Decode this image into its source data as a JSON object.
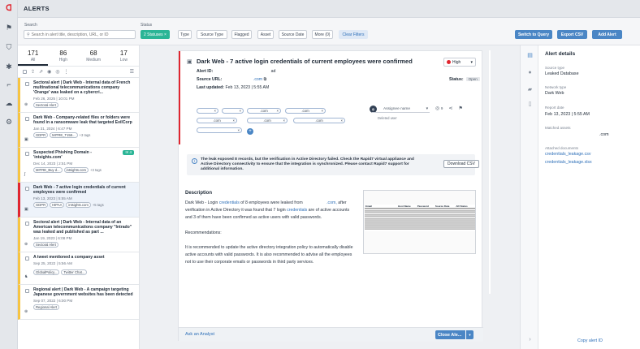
{
  "page_title": "ALERTS",
  "filters": {
    "search_label": "Search",
    "search_placeholder": "Search in alert title, description, URL, or ID",
    "status_label": "Status",
    "status_chip": "2 Statuses",
    "buttons": [
      "Type",
      "Source Type",
      "Flagged",
      "Asset",
      "Source Date",
      "More (0)"
    ],
    "clear": "Clear Filters",
    "switch_query": "Switch to Query",
    "export_csv": "Export CSV",
    "add_alert": "Add Alert"
  },
  "counts": [
    {
      "n": "171",
      "label": "All"
    },
    {
      "n": "86",
      "label": "High"
    },
    {
      "n": "68",
      "label": "Medium"
    },
    {
      "n": "17",
      "label": "Low"
    }
  ],
  "alerts": [
    {
      "title": "Sectoral alert | Dark Web - Internal data of French multinational telecommunications company 'Orange' was leaked on a cybercri...",
      "date": "Feb 26, 2025 | 10:01 PM",
      "tags": [
        "Sectoral Alert"
      ],
      "more": ""
    },
    {
      "title": "Dark Web - Company-related files or folders were found in a ransomware leak that targeted EvilCorp",
      "date": "Jan 31, 2024 | 6:47 PM",
      "tags": [
        "GDPR",
        "MITRE_T158..."
      ],
      "more": "+3 tags"
    },
    {
      "title": "Suspected Phishing Domain - 'intsights.com'",
      "date": "Dec 14, 2023 | 2:51 PM",
      "tags": [
        "MITRE_Buy d...",
        "intsights.com"
      ],
      "more": "+3 tags",
      "badge": "4"
    },
    {
      "title": "Dark Web - 7 active login credentials of current employees were confirmed",
      "date": "Feb 13, 2023 | 5:55 AM",
      "tags": [
        "GDPR",
        "HIPAA",
        "intsights.com"
      ],
      "more": "+5 tags"
    },
    {
      "title": "Sectoral alert | Dark Web - Internal data of an American telecommunications company \"Intrado\" was leaked and published as part ...",
      "date": "Jan 19, 2023 | 6:08 PM",
      "tags": [
        "Sectoral Alert"
      ],
      "more": ""
    },
    {
      "title": "A tweet mentioned a company asset",
      "date": "Sep 25, 2022 | 5:56 AM",
      "tags": [
        "GlobalPolicy...",
        "Twitter Chat..."
      ],
      "more": ""
    },
    {
      "title": "Regional alert | Dark Web - A campaign targeting Japanese government websites has been detected",
      "date": "Sep 07, 2022 | 6:00 PM",
      "tags": [
        "Regional Alert"
      ],
      "more": ""
    }
  ],
  "detail": {
    "title": "Dark Web - 7 active login credentials of current employees were confirmed",
    "alert_id_label": "Alert ID:",
    "alert_id_value": "ad",
    "source_url_label": "Source URL:",
    "source_url_value": ".com",
    "last_updated_label": "Last updated:",
    "last_updated_value": "Feb 13, 2023 | 5:55 AM",
    "severity": "High",
    "status_label": "Status:",
    "status_value": "Open",
    "pills": [
      "",
      "",
      ".com",
      ".com",
      ".com",
      ".com",
      ".com",
      ""
    ],
    "assignee_placeholder": "Assignee name",
    "deleted_user": "Deleted user",
    "views": "9",
    "warning": "The leak exposed 8 records, but the verification in Active Directory failed. Check the Rapid7 virtual appliance and Active Directory connectivity to ensure that the integration is synchronized. Please contact Rapid7 support for additional information.",
    "download_csv": "Download CSV",
    "description_heading": "Description",
    "desc_part1": "Dark Web - Login ",
    "desc_link1": "credentials",
    "desc_part2": " of 8 employees were leaked from ",
    "desc_link2": ".com,",
    "desc_part3": " after verification in Active Directory it was found that 7 login ",
    "desc_link3": "credentials",
    "desc_part4": " are of active accounts and 3 of them have been confirmed as active users with valid passwords.",
    "recommendations_label": "Recommendations:",
    "recommendations_text": "It is recommended to update the active directory integration policy to automatically disable active accounts with valid passwords. It is also recommended to advise all the employees not to use their corporate emails or passwords in third party services.",
    "thumb_headers": [
      "Email",
      "Host Name",
      "Password",
      "Source Date",
      "AD Status"
    ],
    "ask_analyst": "Ask an Analyst",
    "close_alert": "Close Ale..."
  },
  "details_panel": {
    "title": "Alert details",
    "source_type_label": "Source type",
    "source_type_value": "Leaked Database",
    "network_type_label": "Network type",
    "network_type_value": "Dark Web",
    "report_date_label": "Report date",
    "report_date_value": "Feb 13, 2023 | 5:55 AM",
    "matched_assets_label": "Matched assets",
    "matched_assets_value": ".com",
    "attached_label": "Attached documents",
    "doc1": "credentials_leakage.csv",
    "doc2": "credentials_leakage.xlsx",
    "copy_id": "Copy alert ID"
  }
}
